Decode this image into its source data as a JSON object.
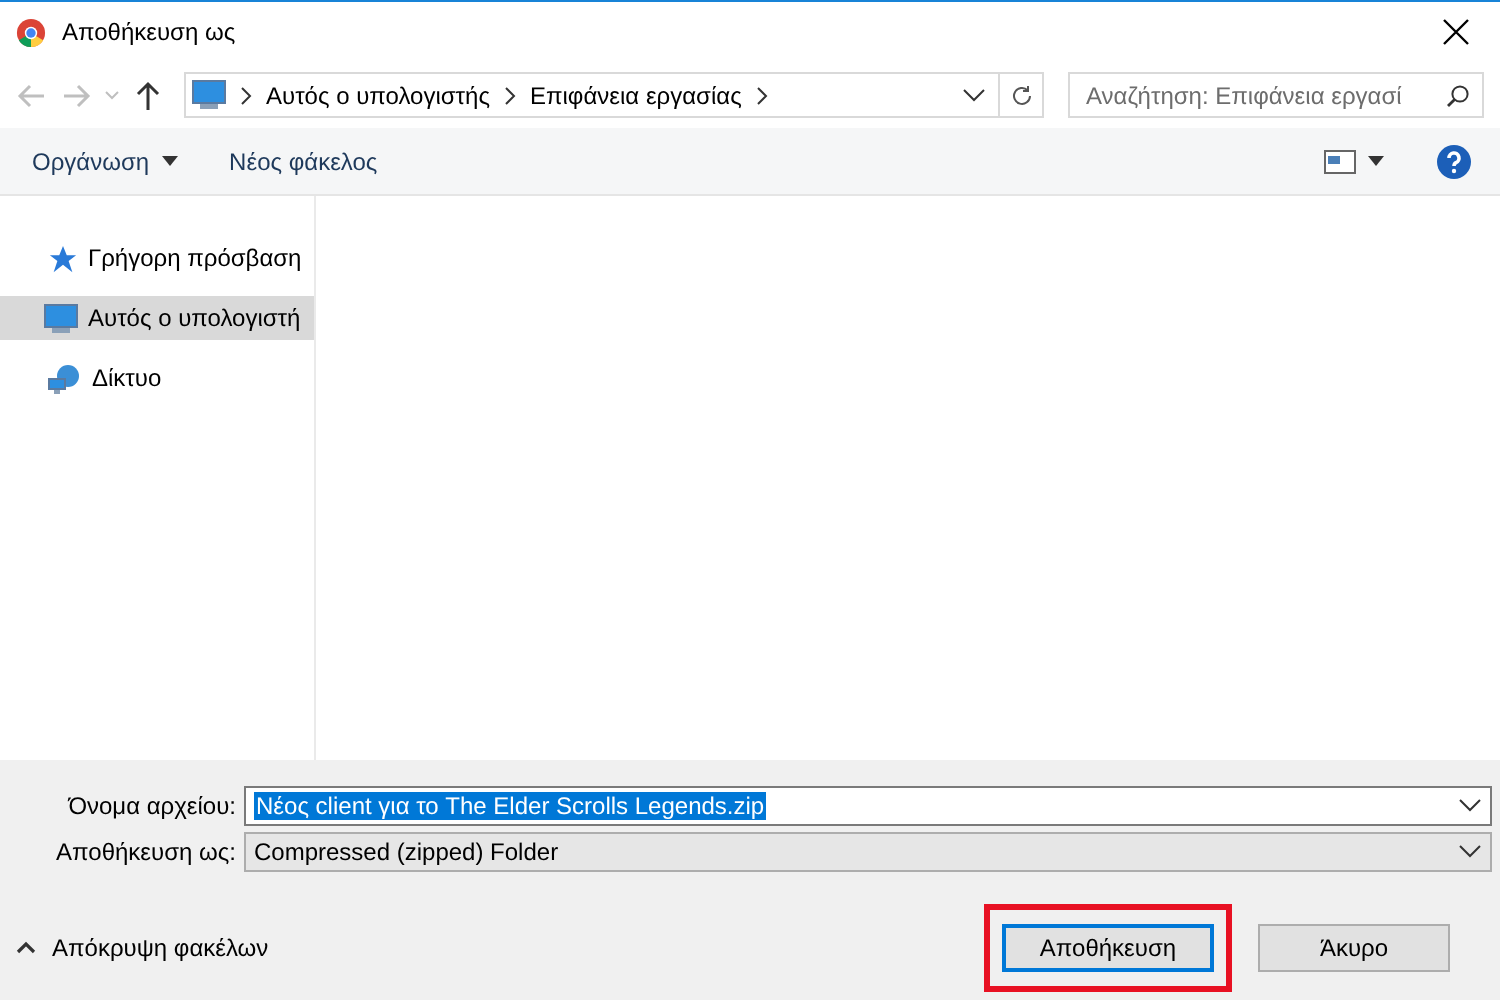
{
  "window": {
    "title": "Αποθήκευση ως"
  },
  "nav": {
    "breadcrumbs": [
      "Αυτός ο υπολογιστής",
      "Επιφάνεια εργασίας"
    ],
    "search": {
      "placeholder": "Αναζήτηση: Επιφάνεια εργασί"
    }
  },
  "toolbar": {
    "organize": "Οργάνωση",
    "new_folder": "Νέος φάκελος"
  },
  "sidebar": {
    "items": [
      {
        "label": "Γρήγορη πρόσβαση",
        "kind": "quick",
        "selected": false
      },
      {
        "label": "Αυτός ο υπολογιστή",
        "kind": "computer",
        "selected": true
      },
      {
        "label": "Δίκτυο",
        "kind": "network",
        "selected": false
      }
    ]
  },
  "form": {
    "filename_label": "Όνομα αρχείου:",
    "filename": "Νέος client για το The Elder Scrolls Legends.zip",
    "type_label": "Αποθήκευση ως:",
    "type": "Compressed (zipped) Folder"
  },
  "footer": {
    "hide_folders": "Απόκρυψη φακέλων",
    "buttons": [
      {
        "label": "Αποθήκευση",
        "highlighted": true
      },
      {
        "label": "Άκυρο",
        "highlighted": false
      }
    ]
  }
}
